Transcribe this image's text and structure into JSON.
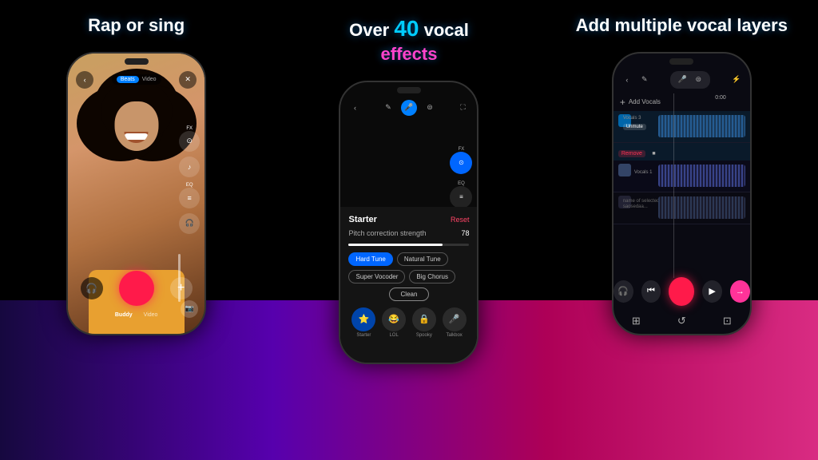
{
  "background": "#000000",
  "columns": [
    {
      "id": "col1",
      "header": "Rap or sing",
      "header_color": "#ffffff",
      "phone": {
        "topbar": {
          "back_icon": "←",
          "tabs": [
            "Beats",
            "Video"
          ],
          "active_tab": "Beats",
          "close_icon": "✕"
        },
        "right_icons": [
          {
            "label": "FX",
            "icon": "🎛"
          },
          {
            "label": "",
            "icon": "🎵"
          },
          {
            "label": "EQ",
            "icon": "📊"
          },
          {
            "label": "",
            "icon": "🎧"
          }
        ],
        "bottom": {
          "tabs": [
            "Beats",
            "Video"
          ],
          "active": "Beats",
          "record_color": "#ff1a4a"
        }
      }
    },
    {
      "id": "col2",
      "header": "Over 40 vocal effects",
      "header_number": "40",
      "phone": {
        "effect_category": "Starter",
        "reset_label": "Reset",
        "pitch_label": "Pitch correction strength",
        "pitch_value": "78",
        "effects_row1": [
          "Hard Tune",
          "Natural Tune"
        ],
        "effects_row2": [
          "Super Vocoder",
          "Big Chorus"
        ],
        "effects_row3": [
          "Clean"
        ],
        "active_effect": "Hard Tune",
        "bottom_icons": [
          {
            "label": "Starter",
            "icon": "⭐",
            "active": true
          },
          {
            "label": "LOL",
            "icon": "😂"
          },
          {
            "label": "Spooky",
            "icon": "🔒"
          },
          {
            "label": "Talkbox",
            "icon": "🎤"
          }
        ]
      }
    },
    {
      "id": "col3",
      "header": "Add multiple vocal layers",
      "phone": {
        "tracks": [
          {
            "name": "Vocals 3",
            "type": "blue",
            "actions": [
              "Unmute"
            ]
          },
          {
            "name": "Remove",
            "type": "red-action"
          },
          {
            "name": "Vocals 1",
            "type": "dark-blue"
          },
          {
            "name": "name of selected\nsaosedaasds...",
            "type": "dark"
          }
        ],
        "add_vocals_label": "Add Vocals",
        "playback": {
          "record_color": "#ff1a4a",
          "next_color": "#ff3399"
        }
      }
    }
  ]
}
